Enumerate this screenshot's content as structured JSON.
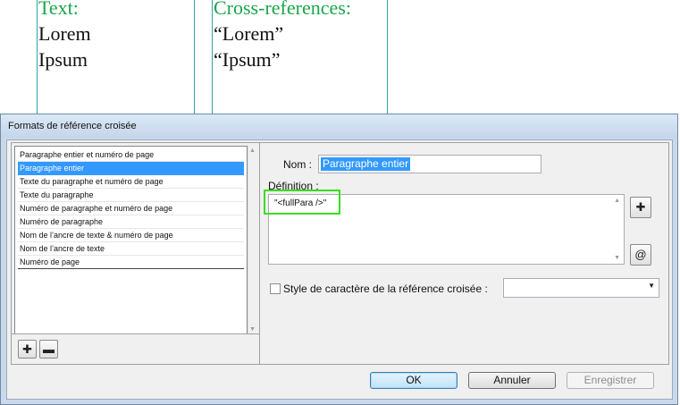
{
  "document": {
    "text_frame": {
      "heading": "Text:",
      "lines": [
        "Lorem",
        "Ipsum"
      ]
    },
    "xref_frame": {
      "heading": "Cross-references:",
      "lines": [
        "“Lorem”",
        "“Ipsum”"
      ]
    }
  },
  "dialog": {
    "title": "Formats de référence croisée",
    "formats": [
      "Paragraphe entier et numéro de page",
      "Paragraphe entier",
      "Texte du paragraphe et numéro de page",
      "Texte du paragraphe",
      "Numéro de paragraphe et numéro de page",
      "Numéro de paragraphe",
      "Nom de l’ancre de texte & numéro de page",
      "Nom de l’ancre de texte",
      "Numéro de page"
    ],
    "selected_index": 1,
    "name_label": "Nom :",
    "name_value": "Paragraphe entier",
    "definition_label": "Définition :",
    "definition_value": "\"<fullPara />\"",
    "insert_building_block_icon": "plus-insert-icon",
    "insert_special_char_icon": "at-sign-icon",
    "char_style_label": "Style de caractère de la référence croisée :",
    "char_style_checked": false,
    "char_style_value": "",
    "add_icon": "plus-icon",
    "remove_icon": "minus-icon",
    "buttons": {
      "ok": "OK",
      "cancel": "Annuler",
      "save": "Enregistrer"
    }
  }
}
